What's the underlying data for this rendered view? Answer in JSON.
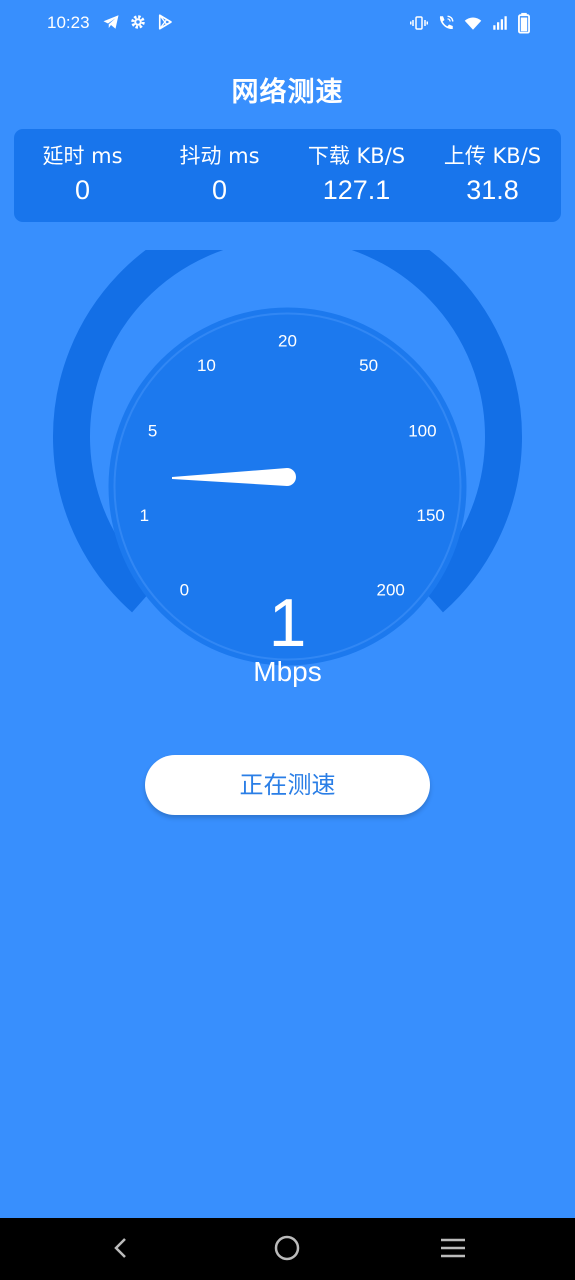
{
  "status_bar": {
    "time": "10:23",
    "left_icons": [
      "telegram-icon",
      "gear-icon",
      "play-store-icon"
    ],
    "right_icons": [
      "vibrate-icon",
      "wifi-calling-icon",
      "wifi-icon",
      "signal-icon",
      "battery-icon"
    ]
  },
  "title": "网络测速",
  "stats": {
    "latency": {
      "label": "延时 ms",
      "value": "0"
    },
    "jitter": {
      "label": "抖动 ms",
      "value": "0"
    },
    "download": {
      "label": "下载 KB/S",
      "value": "127.1"
    },
    "upload": {
      "label": "上传 KB/S",
      "value": "31.8"
    }
  },
  "gauge": {
    "ticks": [
      "0",
      "1",
      "5",
      "10",
      "20",
      "50",
      "100",
      "150",
      "200"
    ],
    "current_tick": "1",
    "colors": {
      "background": "#388ffd",
      "outer_ring": "#136fe6",
      "inner_dial": "#1c79ee",
      "needle": "#ffffff"
    }
  },
  "speed": {
    "value": "1",
    "unit": "Mbps"
  },
  "action_button": {
    "label": "正在测速"
  },
  "nav_bar": {
    "buttons": [
      "back-icon",
      "home-icon",
      "recents-icon"
    ]
  }
}
